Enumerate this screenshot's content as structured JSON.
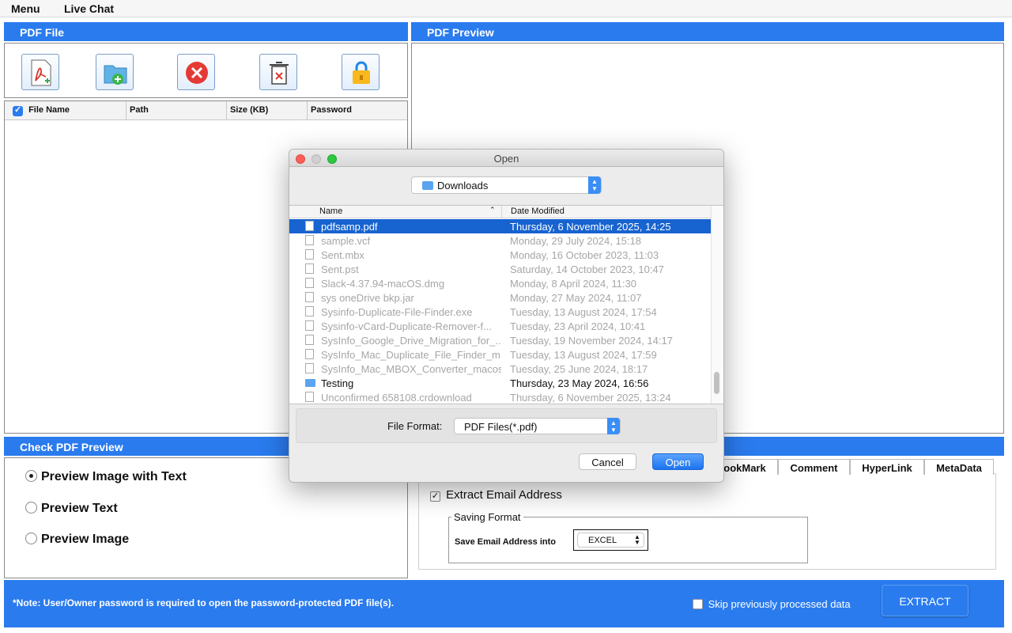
{
  "menubar": {
    "menu": "Menu",
    "live_chat": "Live Chat"
  },
  "pdf_file": {
    "title": "PDF File",
    "columns": [
      "File Name",
      "Path",
      "Size (KB)",
      "Password"
    ],
    "select_all_checked": true
  },
  "pdf_preview": {
    "title": "PDF Preview"
  },
  "check_preview": {
    "title": "Check PDF Preview",
    "options": [
      "Preview Image with Text",
      "Preview Text",
      "Preview Image"
    ],
    "selected": "Preview Image with Text"
  },
  "right_panel": {
    "tabs": [
      "ookMark",
      "Comment",
      "HyperLink",
      "MetaData"
    ],
    "extract_email_label": "Extract Email Address",
    "extract_email_checked": true,
    "saving_format_legend": "Saving Format",
    "save_email_label": "Save Email Address into",
    "save_format_value": "EXCEL"
  },
  "footer": {
    "note": "*Note: User/Owner password is required to open the password-protected PDF file(s).",
    "skip_label": "Skip previously processed data",
    "extract_label": "EXTRACT"
  },
  "dialog": {
    "title": "Open",
    "location": "Downloads",
    "columns": {
      "name": "Name",
      "date": "Date Modified"
    },
    "files": [
      {
        "name": "pdfsamp.pdf",
        "date": "Thursday, 6 November 2025, 14:25",
        "state": "selected",
        "kind": "file"
      },
      {
        "name": "sample.vcf",
        "date": "Monday, 29 July 2024, 15:18",
        "state": "dim",
        "kind": "file"
      },
      {
        "name": "Sent.mbx",
        "date": "Monday, 16 October 2023, 11:03",
        "state": "dim",
        "kind": "file"
      },
      {
        "name": "Sent.pst",
        "date": "Saturday, 14 October 2023, 10:47",
        "state": "dim",
        "kind": "file"
      },
      {
        "name": "Slack-4.37.94-macOS.dmg",
        "date": "Monday, 8 April 2024, 11:30",
        "state": "dim",
        "kind": "file"
      },
      {
        "name": "sys oneDrive bkp.jar",
        "date": "Monday, 27 May 2024, 11:07",
        "state": "dim",
        "kind": "file"
      },
      {
        "name": "Sysinfo-Duplicate-File-Finder.exe",
        "date": "Tuesday, 13 August 2024, 17:54",
        "state": "dim",
        "kind": "file"
      },
      {
        "name": "Sysinfo-vCard-Duplicate-Remover-f...",
        "date": "Tuesday, 23 April 2024, 10:41",
        "state": "dim",
        "kind": "file"
      },
      {
        "name": "SysInfo_Google_Drive_Migration_for_...",
        "date": "Tuesday, 19 November 2024, 14:17",
        "state": "dim",
        "kind": "file"
      },
      {
        "name": "SysInfo_Mac_Duplicate_File_Finder_m...",
        "date": "Tuesday, 13 August 2024, 17:59",
        "state": "dim",
        "kind": "file"
      },
      {
        "name": "SysInfo_Mac_MBOX_Converter_macos...",
        "date": "Tuesday, 25 June 2024, 18:17",
        "state": "dim",
        "kind": "file"
      },
      {
        "name": "Testing",
        "date": "Thursday, 23 May 2024, 16:56",
        "state": "normal",
        "kind": "folder"
      },
      {
        "name": "Unconfirmed 658108.crdownload",
        "date": "Thursday, 6 November 2025, 13:24",
        "state": "dim",
        "kind": "file"
      }
    ],
    "file_format_label": "File Format:",
    "file_format_value": "PDF Files(*.pdf)",
    "cancel_label": "Cancel",
    "open_label": "Open"
  },
  "colors": {
    "accent": "#2a7bee",
    "selection": "#1763d0"
  }
}
